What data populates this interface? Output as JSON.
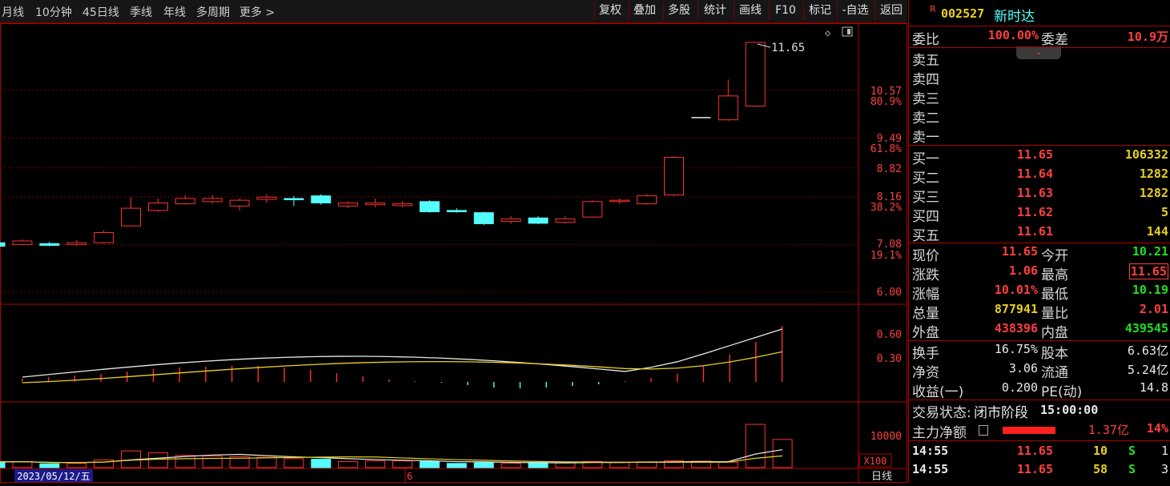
{
  "toolbar": {
    "periods": [
      "月线",
      "10分钟",
      "45日线",
      "季线",
      "年线",
      "多周期",
      "更多 >"
    ],
    "buttons": [
      "复权",
      "叠加",
      "多股",
      "统计",
      "画线",
      "F10",
      "标记",
      "-自选",
      "返回"
    ]
  },
  "chart": {
    "max_label": "11.65",
    "price_axis": [
      {
        "price": "10.57",
        "pct": "80.9%"
      },
      {
        "price": "9.49",
        "pct": "61.8%"
      },
      {
        "price": "8.82",
        "pct": ""
      },
      {
        "price": "8.16",
        "pct": "38.2%"
      },
      {
        "price": "7.08",
        "pct": "19.1%"
      },
      {
        "price": "6.00",
        "pct": ""
      }
    ],
    "macd_axis": [
      "0.60",
      "0.30"
    ],
    "vol_axis": "10000",
    "vol_unit": "X100",
    "date_label": "2023/05/12/五",
    "month_label": "6",
    "period_label": "日线"
  },
  "chart_data": {
    "type": "candlestick",
    "title": "",
    "ylim": [
      6.0,
      11.65
    ],
    "candles": [
      {
        "o": 7.12,
        "c": 7.04,
        "h": 7.16,
        "l": 7.0,
        "up": false
      },
      {
        "o": 7.08,
        "c": 7.16,
        "h": 7.2,
        "l": 7.06,
        "up": true
      },
      {
        "o": 7.1,
        "c": 7.06,
        "h": 7.14,
        "l": 7.04,
        "up": false
      },
      {
        "o": 7.08,
        "c": 7.12,
        "h": 7.18,
        "l": 7.05,
        "up": true
      },
      {
        "o": 7.12,
        "c": 7.35,
        "h": 7.4,
        "l": 7.1,
        "up": true
      },
      {
        "o": 7.5,
        "c": 7.9,
        "h": 8.15,
        "l": 7.48,
        "up": true
      },
      {
        "o": 7.85,
        "c": 8.02,
        "h": 8.12,
        "l": 7.82,
        "up": true
      },
      {
        "o": 8.0,
        "c": 8.12,
        "h": 8.2,
        "l": 7.98,
        "up": true
      },
      {
        "o": 8.05,
        "c": 8.12,
        "h": 8.2,
        "l": 8.0,
        "up": true
      },
      {
        "o": 7.95,
        "c": 8.08,
        "h": 8.12,
        "l": 7.85,
        "up": true
      },
      {
        "o": 8.1,
        "c": 8.15,
        "h": 8.22,
        "l": 8.02,
        "up": true
      },
      {
        "o": 8.12,
        "c": 8.1,
        "h": 8.18,
        "l": 7.95,
        "up": false
      },
      {
        "o": 8.18,
        "c": 8.02,
        "h": 8.22,
        "l": 7.98,
        "up": false
      },
      {
        "o": 7.95,
        "c": 8.02,
        "h": 8.06,
        "l": 7.9,
        "up": true
      },
      {
        "o": 7.98,
        "c": 8.02,
        "h": 8.12,
        "l": 7.92,
        "up": true
      },
      {
        "o": 7.96,
        "c": 8.0,
        "h": 8.05,
        "l": 7.92,
        "up": true
      },
      {
        "o": 8.05,
        "c": 7.82,
        "h": 8.08,
        "l": 7.8,
        "up": false
      },
      {
        "o": 7.85,
        "c": 7.82,
        "h": 7.9,
        "l": 7.8,
        "up": false
      },
      {
        "o": 7.8,
        "c": 7.55,
        "h": 7.82,
        "l": 7.52,
        "up": false
      },
      {
        "o": 7.6,
        "c": 7.66,
        "h": 7.72,
        "l": 7.55,
        "up": true
      },
      {
        "o": 7.68,
        "c": 7.56,
        "h": 7.72,
        "l": 7.54,
        "up": false
      },
      {
        "o": 7.58,
        "c": 7.66,
        "h": 7.72,
        "l": 7.55,
        "up": true
      },
      {
        "o": 7.7,
        "c": 8.05,
        "h": 8.08,
        "l": 7.68,
        "up": true
      },
      {
        "o": 8.05,
        "c": 8.08,
        "h": 8.12,
        "l": 8.0,
        "up": true
      },
      {
        "o": 8.0,
        "c": 8.18,
        "h": 8.22,
        "l": 7.98,
        "up": true
      },
      {
        "o": 8.2,
        "c": 9.05,
        "h": 9.08,
        "l": 8.18,
        "up": true
      },
      {
        "o": 9.95,
        "c": 9.95,
        "h": 9.95,
        "l": 9.95,
        "up": true
      },
      {
        "o": 9.9,
        "c": 10.44,
        "h": 10.81,
        "l": 9.88,
        "up": true
      },
      {
        "o": 10.21,
        "c": 11.65,
        "h": 11.65,
        "l": 10.19,
        "up": true
      }
    ],
    "macd_bars": [
      0.04,
      0.06,
      0.08,
      0.1,
      0.13,
      0.16,
      0.18,
      0.19,
      0.2,
      0.2,
      0.18,
      0.15,
      0.11,
      0.07,
      0.03,
      0.01,
      -0.01,
      -0.04,
      -0.07,
      -0.08,
      -0.07,
      -0.05,
      -0.03,
      0.01,
      0.05,
      0.1,
      0.2,
      0.34,
      0.5,
      0.7
    ],
    "volume": [
      {
        "v": 1800,
        "up": false
      },
      {
        "v": 1900,
        "up": true
      },
      {
        "v": 1200,
        "up": false
      },
      {
        "v": 1300,
        "up": true
      },
      {
        "v": 2400,
        "up": true
      },
      {
        "v": 5200,
        "up": true
      },
      {
        "v": 4600,
        "up": true
      },
      {
        "v": 3800,
        "up": true
      },
      {
        "v": 3600,
        "up": true
      },
      {
        "v": 3400,
        "up": true
      },
      {
        "v": 3200,
        "up": true
      },
      {
        "v": 2800,
        "up": true
      },
      {
        "v": 2600,
        "up": false
      },
      {
        "v": 1900,
        "up": true
      },
      {
        "v": 2100,
        "up": true
      },
      {
        "v": 2100,
        "up": true
      },
      {
        "v": 1900,
        "up": false
      },
      {
        "v": 1300,
        "up": false
      },
      {
        "v": 1500,
        "up": false
      },
      {
        "v": 1300,
        "up": true
      },
      {
        "v": 1600,
        "up": false
      },
      {
        "v": 1600,
        "up": true
      },
      {
        "v": 1900,
        "up": true
      },
      {
        "v": 1600,
        "up": true
      },
      {
        "v": 1800,
        "up": true
      },
      {
        "v": 2100,
        "up": true
      },
      {
        "v": 2000,
        "up": true
      },
      {
        "v": 1700,
        "up": true
      },
      {
        "v": 13500,
        "up": true
      },
      {
        "v": 8778,
        "up": true
      }
    ]
  },
  "quote": {
    "badge": "R",
    "code": "002527",
    "name": "新时达",
    "weibi_label": "委比",
    "weibi": "100.00%",
    "weicha_label": "委差",
    "weicha": "10.9万",
    "sell": [
      {
        "label": "卖五",
        "price": "",
        "vol": ""
      },
      {
        "label": "卖四",
        "price": "",
        "vol": ""
      },
      {
        "label": "卖三",
        "price": "",
        "vol": ""
      },
      {
        "label": "卖二",
        "price": "",
        "vol": ""
      },
      {
        "label": "卖一",
        "price": "",
        "vol": ""
      }
    ],
    "buy": [
      {
        "label": "买一",
        "price": "11.65",
        "vol": "106332"
      },
      {
        "label": "买二",
        "price": "11.64",
        "vol": "1282"
      },
      {
        "label": "买三",
        "price": "11.63",
        "vol": "1282"
      },
      {
        "label": "买四",
        "price": "11.62",
        "vol": "5"
      },
      {
        "label": "买五",
        "price": "11.61",
        "vol": "144"
      }
    ],
    "stats": [
      {
        "l1": "现价",
        "v1": "11.65",
        "c1": "red",
        "l2": "今开",
        "v2": "10.21",
        "c2": "green"
      },
      {
        "l1": "涨跌",
        "v1": "1.06",
        "c1": "red",
        "l2": "最高",
        "v2": "11.65",
        "c2": "red"
      },
      {
        "l1": "涨幅",
        "v1": "10.01%",
        "c1": "red",
        "l2": "最低",
        "v2": "10.19",
        "c2": "green"
      },
      {
        "l1": "总量",
        "v1": "877941",
        "c1": "yellow",
        "l2": "量比",
        "v2": "2.01",
        "c2": "red"
      },
      {
        "l1": "外盘",
        "v1": "438396",
        "c1": "red",
        "l2": "内盘",
        "v2": "439545",
        "c2": "green"
      }
    ],
    "fund": [
      {
        "l1": "换手",
        "v1": "16.75%",
        "l2": "股本",
        "v2": "6.63亿"
      },
      {
        "l1": "净资",
        "v1": "3.06",
        "l2": "流通",
        "v2": "5.24亿"
      },
      {
        "l1": "收益(一)",
        "v1": "0.200",
        "l2": "PE(动)",
        "v2": "14.8"
      }
    ],
    "status_label": "交易状态:",
    "status": "闭市阶段",
    "status_time": "15:00:00",
    "mainflow_label": "主力净额",
    "mainflow": "1.37亿",
    "mainflow_pct": "14%",
    "ticks": [
      {
        "time": "14:55",
        "price": "11.65",
        "vol": "10",
        "side": "S",
        "n": "1"
      },
      {
        "time": "14:55",
        "price": "11.65",
        "vol": "58",
        "side": "S",
        "n": "3"
      }
    ],
    "colors": {
      "up": "#ff3232",
      "down": "#54ffff",
      "border": "#b00000"
    }
  }
}
